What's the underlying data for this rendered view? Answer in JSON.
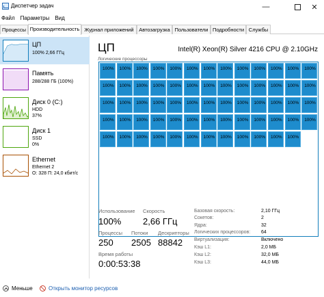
{
  "window": {
    "title": "Диспетчер задач"
  },
  "menu": [
    "Файл",
    "Параметры",
    "Вид"
  ],
  "tabs": [
    "Процессы",
    "Производительность",
    "Журнал приложений",
    "Автозагрузка",
    "Пользователи",
    "Подробности",
    "Службы"
  ],
  "sidebar": {
    "items": [
      {
        "name": "ЦП",
        "lines": [
          "100% 2,66 ГГц"
        ]
      },
      {
        "name": "Память",
        "lines": [
          "288/288 ГБ (100%)"
        ]
      },
      {
        "name": "Диск 0 (C:)",
        "lines": [
          "HDD",
          "37%"
        ]
      },
      {
        "name": "Диск 1",
        "lines": [
          "SSD",
          "0%"
        ]
      },
      {
        "name": "Ethernet",
        "lines": [
          "Ethernet 2",
          "О: 328 П: 24,0 кбит/с"
        ]
      }
    ]
  },
  "main": {
    "title": "ЦП",
    "cpu_model": "Intel(R) Xeon(R) Silver 4216 CPU @ 2.10GHz",
    "grid_label": "Логические процессоры",
    "cell_value": "100%",
    "cell_count": 64
  },
  "stats": {
    "usage_label": "Использование",
    "usage_value": "100%",
    "speed_label": "Скорость",
    "speed_value": "2,66 ГГц",
    "processes_label": "Процессы",
    "processes_value": "250",
    "threads_label": "Потоки",
    "threads_value": "2505",
    "handles_label": "Дескрипторы",
    "handles_value": "88842",
    "uptime_label": "Время работы",
    "uptime_value": "0:00:53:38"
  },
  "info": [
    {
      "label": "Базовая скорость:",
      "value": "2,10 ГГц"
    },
    {
      "label": "Сокетов:",
      "value": "2"
    },
    {
      "label": "Ядра:",
      "value": "32"
    },
    {
      "label": "Логических процессоров:",
      "value": "64"
    },
    {
      "label": "Виртуализация:",
      "value": "Включено"
    },
    {
      "label": "Кэш L1:",
      "value": "2,0 МБ"
    },
    {
      "label": "Кэш L2:",
      "value": "32,0 МБ"
    },
    {
      "label": "Кэш L3:",
      "value": "44,0 МБ"
    }
  ],
  "footer": {
    "less_label": "Меньше",
    "monitor_label": "Открыть монитор ресурсов"
  },
  "colors": {
    "accent": "#117dbb",
    "cell": "#1e8ccd",
    "selected": "#cce4f7"
  }
}
